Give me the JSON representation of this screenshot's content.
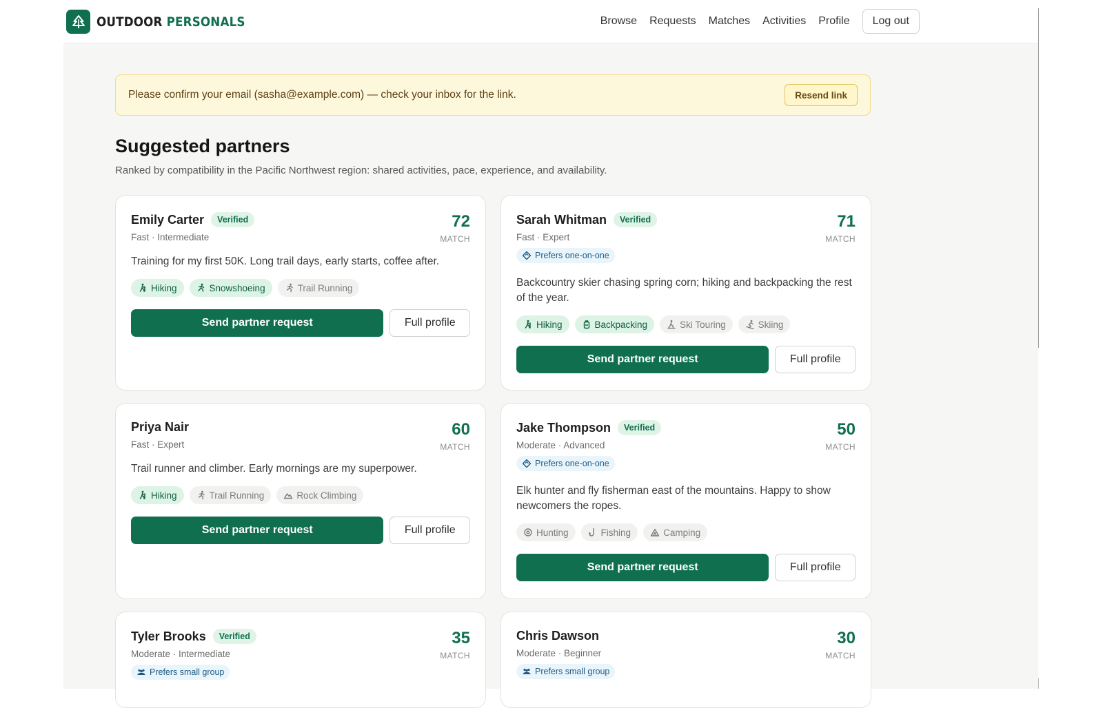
{
  "header": {
    "brand_part1": "OUTDOOR",
    "brand_part2": "PERSONALS",
    "nav": [
      "Browse",
      "Requests",
      "Matches",
      "Activities",
      "Profile"
    ],
    "logout_label": "Log out"
  },
  "banner": {
    "text": "Please confirm your email (sasha@example.com) — check your inbox for the link.",
    "button_label": "Resend link"
  },
  "page": {
    "title": "Suggested partners",
    "subtitle": "Ranked by compatibility in the Pacific Northwest region: shared activities, pace, experience, and availability."
  },
  "labels": {
    "verified": "Verified",
    "match": "MATCH",
    "send": "Send partner request",
    "full_profile": "Full profile"
  },
  "colors": {
    "brand_green": "#0f6f4e",
    "banner_bg": "#fdf7dc"
  },
  "cards": [
    {
      "name": "Emily Carter",
      "verified": true,
      "meta": "Fast · Intermediate",
      "score": "72",
      "preference": "",
      "preference_icon": "",
      "bio": "Training for my first 50K. Long trail days, early starts, coffee after.",
      "tags": [
        {
          "label": "Hiking",
          "shared": true,
          "icon": "hiker-icon"
        },
        {
          "label": "Snowshoeing",
          "shared": true,
          "icon": "snowshoe-icon"
        },
        {
          "label": "Trail Running",
          "shared": false,
          "icon": "runner-icon"
        }
      ]
    },
    {
      "name": "Sarah Whitman",
      "verified": true,
      "meta": "Fast · Expert",
      "score": "71",
      "preference": "Prefers one-on-one",
      "preference_icon": "diamond-icon",
      "bio": "Backcountry skier chasing spring corn; hiking and backpacking the rest of the year.",
      "tags": [
        {
          "label": "Hiking",
          "shared": true,
          "icon": "hiker-icon"
        },
        {
          "label": "Backpacking",
          "shared": true,
          "icon": "backpack-icon"
        },
        {
          "label": "Ski Touring",
          "shared": false,
          "icon": "ski-touring-icon"
        },
        {
          "label": "Skiing",
          "shared": false,
          "icon": "skier-icon"
        }
      ]
    },
    {
      "name": "Priya Nair",
      "verified": false,
      "meta": "Fast · Expert",
      "score": "60",
      "preference": "",
      "preference_icon": "",
      "bio": "Trail runner and climber. Early mornings are my superpower.",
      "tags": [
        {
          "label": "Hiking",
          "shared": true,
          "icon": "hiker-icon"
        },
        {
          "label": "Trail Running",
          "shared": false,
          "icon": "runner-icon"
        },
        {
          "label": "Rock Climbing",
          "shared": false,
          "icon": "mountain-icon"
        }
      ]
    },
    {
      "name": "Jake Thompson",
      "verified": true,
      "meta": "Moderate · Advanced",
      "score": "50",
      "preference": "Prefers one-on-one",
      "preference_icon": "diamond-icon",
      "bio": "Elk hunter and fly fisherman east of the mountains. Happy to show newcomers the ropes.",
      "tags": [
        {
          "label": "Hunting",
          "shared": false,
          "icon": "target-icon"
        },
        {
          "label": "Fishing",
          "shared": false,
          "icon": "fishhook-icon"
        },
        {
          "label": "Camping",
          "shared": false,
          "icon": "tent-icon"
        }
      ]
    },
    {
      "name": "Tyler Brooks",
      "verified": true,
      "meta": "Moderate · Intermediate",
      "score": "35",
      "preference": "Prefers small group",
      "preference_icon": "group-icon",
      "bio": "",
      "tags": []
    },
    {
      "name": "Chris Dawson",
      "verified": false,
      "meta": "Moderate · Beginner",
      "score": "30",
      "preference": "Prefers small group",
      "preference_icon": "group-icon",
      "bio": "",
      "tags": []
    }
  ]
}
